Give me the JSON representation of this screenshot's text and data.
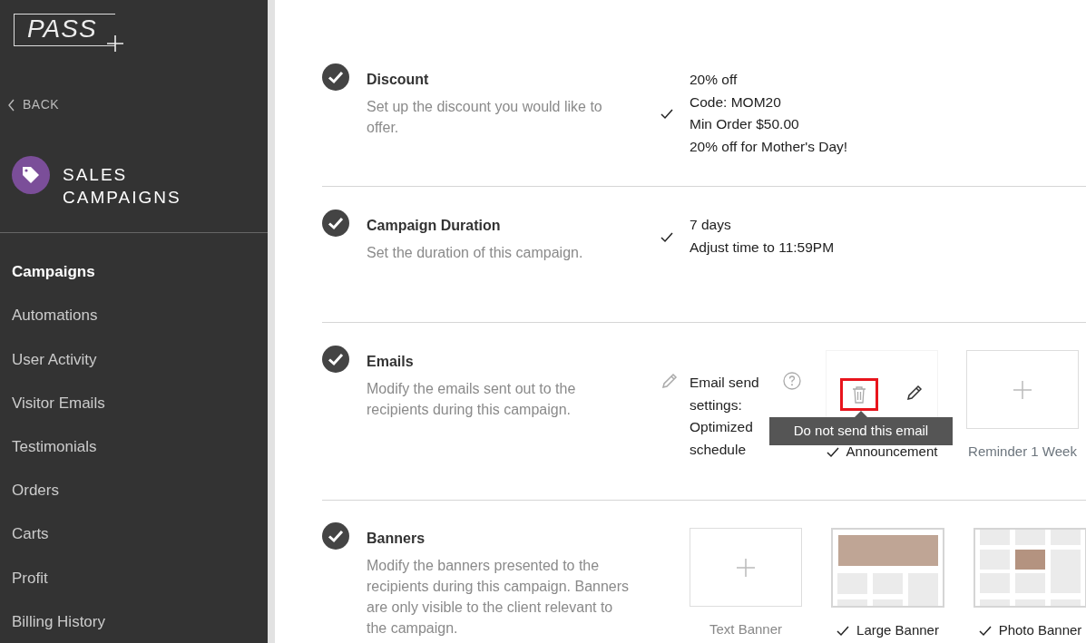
{
  "logo": {
    "text": "PASS"
  },
  "sidebar": {
    "back": "BACK",
    "title": "SALES CAMPAIGNS",
    "items": [
      {
        "label": "Campaigns",
        "selected": true
      },
      {
        "label": "Automations",
        "selected": false
      },
      {
        "label": "User Activity",
        "selected": false
      },
      {
        "label": "Visitor Emails",
        "selected": false
      },
      {
        "label": "Testimonials",
        "selected": false
      },
      {
        "label": "Orders",
        "selected": false
      },
      {
        "label": "Carts",
        "selected": false
      },
      {
        "label": "Profit",
        "selected": false
      },
      {
        "label": "Billing History",
        "selected": false
      }
    ]
  },
  "sections": [
    {
      "kind": "summary",
      "title": "Discount",
      "description": "Set up the discount you would like to offer.",
      "done": true,
      "summary_lines": [
        "20% off",
        "Code: MOM20",
        "Min Order $50.00",
        "20% off for Mother's Day!"
      ]
    },
    {
      "kind": "summary",
      "title": "Campaign Duration",
      "description": "Set the duration of this campaign.",
      "done": true,
      "summary_lines": [
        "7 days",
        "Adjust time to 11:59PM"
      ]
    },
    {
      "kind": "emails",
      "title": "Emails",
      "description": "Modify the emails sent out to the recipients during this campaign.",
      "done": true,
      "send_settings": "Email send settings: Optimized schedule",
      "tooltip": "Do not send this email",
      "emails": [
        {
          "label": "Announcement",
          "checked": true,
          "hovered": true
        },
        {
          "label": "Reminder 1 Week",
          "checked": false,
          "hovered": false
        }
      ]
    },
    {
      "kind": "banners",
      "title": "Banners",
      "description": "Modify the banners presented to the recipients during this campaign. Banners are only visible to the client relevant to the campaign.",
      "done": true,
      "banners": [
        {
          "label": "Text Banner",
          "checked": false,
          "kind": "empty"
        },
        {
          "label": "Large Banner",
          "checked": true,
          "kind": "large"
        },
        {
          "label": "Photo Banner",
          "checked": true,
          "kind": "photo"
        }
      ]
    }
  ]
}
